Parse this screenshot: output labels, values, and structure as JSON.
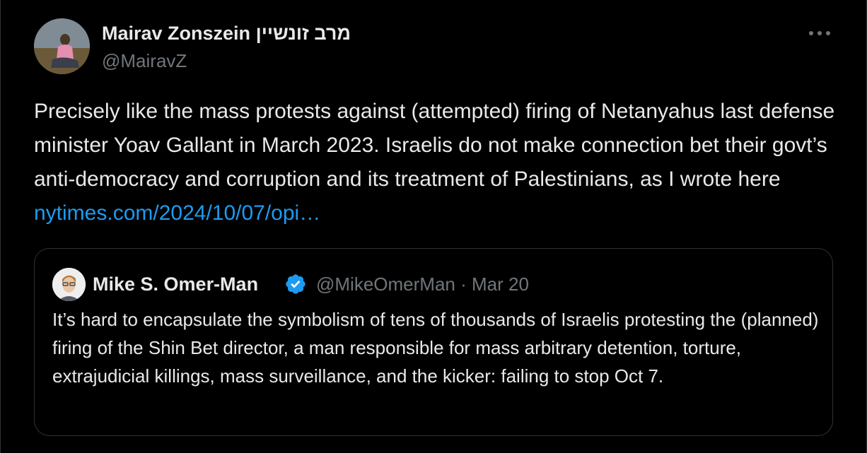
{
  "tweet": {
    "author_name": "Mairav Zonszein מרב זונשיין",
    "author_handle": "@MairavZ",
    "more_icon": "ellipsis-icon",
    "text": "Precisely like the mass protests against (attempted) firing of Netanyahus last defense minister Yoav Gallant in March 2023. Israelis do not make connection bet their govt’s anti-democracy and corruption and its treatment of Palestinians, as I wrote here ",
    "link_text": "nytimes.com/2024/10/07/opi…"
  },
  "quoted_tweet": {
    "author_name": "Mike S. Omer-Man",
    "verified_icon": "verified-badge-icon",
    "author_handle": "@MikeOmerMan",
    "separator": "·",
    "date": "Mar 20",
    "text": "It’s hard to encapsulate the symbolism of tens of thousands of Israelis protesting the (planned) firing of the Shin Bet director, a man responsible for mass arbitrary detention, torture, extrajudicial killings, mass surveillance, and the kicker: failing to stop Oct 7."
  },
  "colors": {
    "background": "#000000",
    "text": "#e7e9ea",
    "secondary": "#71767b",
    "link": "#1d9bf0",
    "border": "#2f3336"
  }
}
